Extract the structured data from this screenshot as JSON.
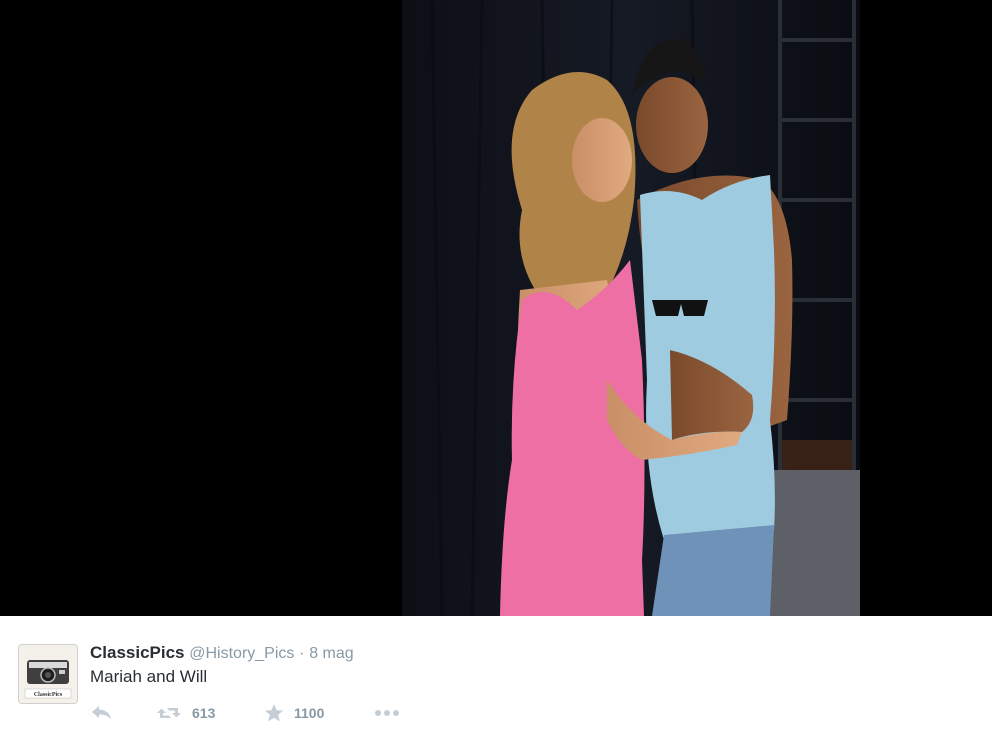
{
  "tweet": {
    "name": "ClassicPics",
    "handle": "@History_Pics",
    "separator": "·",
    "time": "8 mag",
    "text": "Mariah and Will",
    "avatar_label": "ClassicPics",
    "retweet_count": "613",
    "favorite_count": "1100"
  },
  "icons": {
    "reply": "reply-icon",
    "retweet": "retweet-icon",
    "favorite": "star-icon",
    "more": "more-icon"
  },
  "colors": {
    "background": "#000000",
    "text": "#292f33",
    "muted": "#8899a6",
    "action_icon": "#c5ced6"
  }
}
